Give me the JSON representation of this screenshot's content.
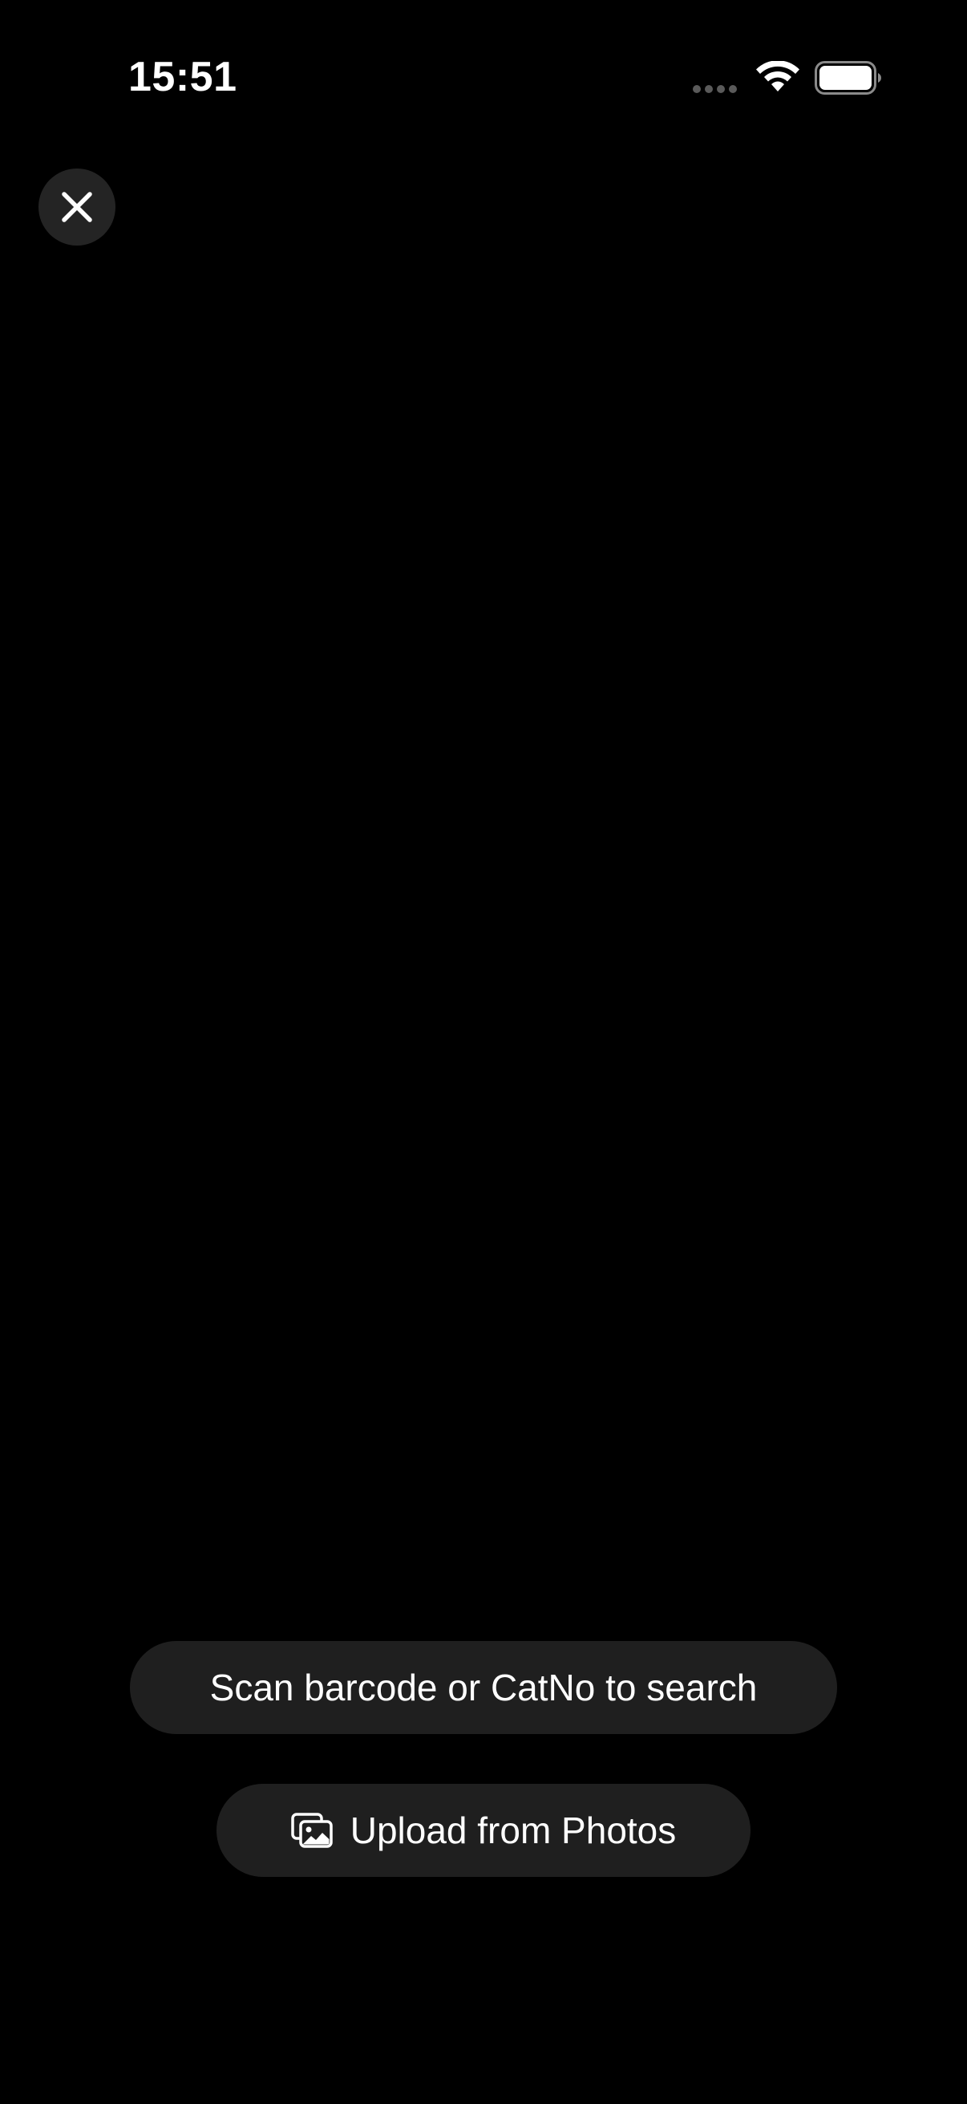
{
  "status_bar": {
    "time": "15:51",
    "icons": [
      "signal-dots-icon",
      "wifi-icon",
      "battery-icon"
    ]
  },
  "toolbar": {
    "close_icon": "close-icon"
  },
  "scanner": {
    "hint": "Scan barcode or CatNo to search",
    "upload_label": "Upload from Photos",
    "upload_icon": "photo-library-icon"
  },
  "colors": {
    "background": "#000000",
    "pill_background": "#1f1f1f",
    "close_button_background": "#242424",
    "text": "#ffffff"
  }
}
